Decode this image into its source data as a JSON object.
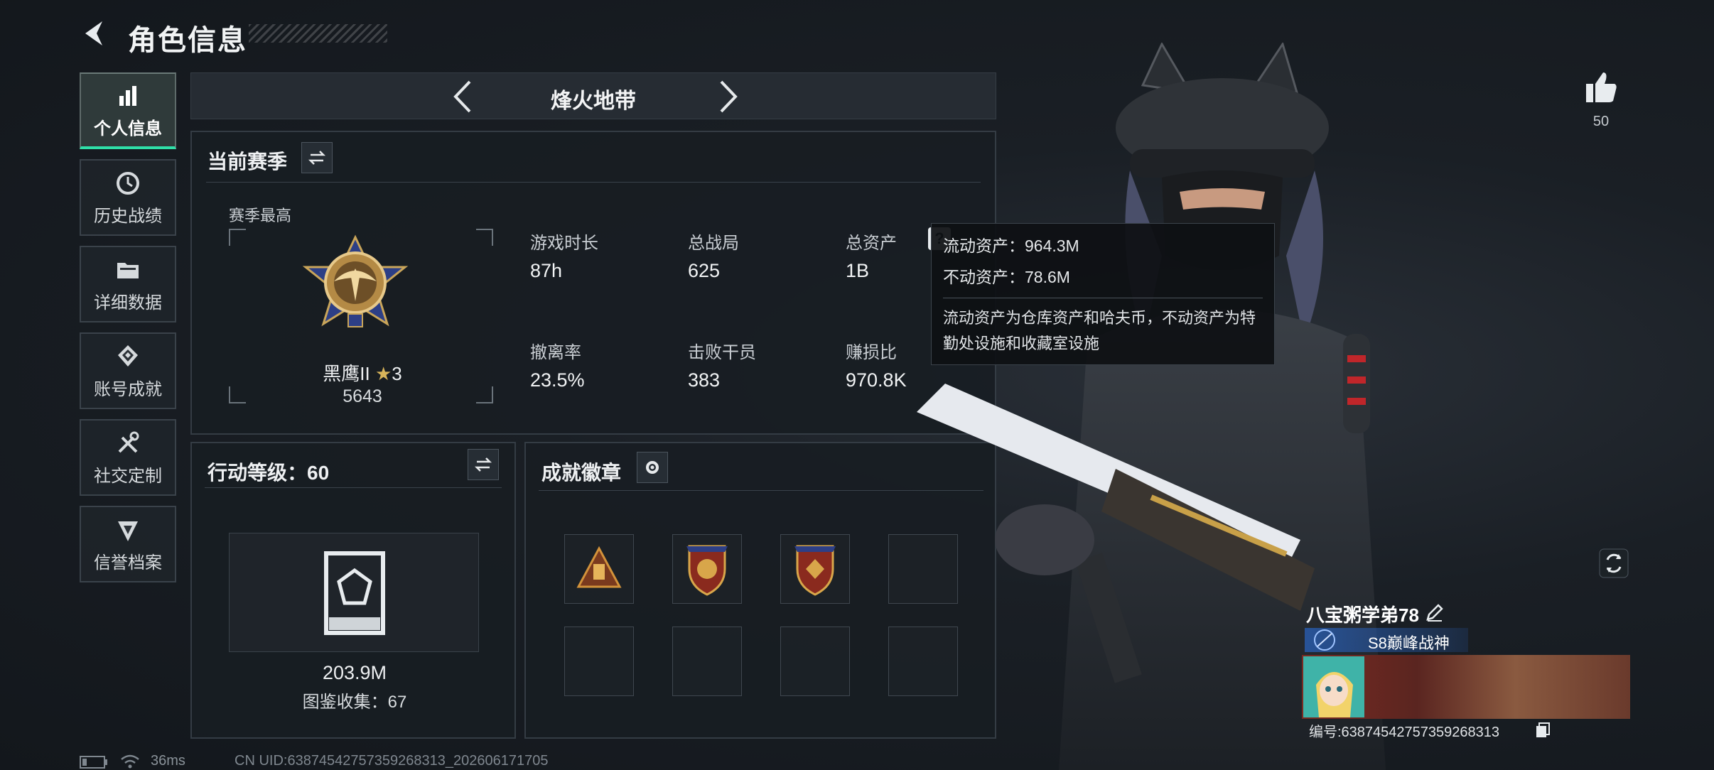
{
  "header": {
    "title": "角色信息"
  },
  "nav": {
    "items": [
      {
        "label": "个人信息",
        "icon": "bar-chart-icon",
        "active": true
      },
      {
        "label": "历史战绩",
        "icon": "history-clock-icon"
      },
      {
        "label": "详细数据",
        "icon": "folder-icon"
      },
      {
        "label": "账号成就",
        "icon": "achievement-icon"
      },
      {
        "label": "社交定制",
        "icon": "tools-icon"
      },
      {
        "label": "信誉档案",
        "icon": "shield-icon"
      }
    ]
  },
  "mode": {
    "title": "烽火地带"
  },
  "season": {
    "title": "当前赛季",
    "best_label": "赛季最高",
    "rank_name": "黑鹰II",
    "rank_stars": "3",
    "rank_points": "5643",
    "stats": [
      {
        "label": "游戏时长",
        "value": "87h"
      },
      {
        "label": "总战局",
        "value": "625"
      },
      {
        "label": "总资产",
        "value": "1B"
      },
      {
        "label": "撤离率",
        "value": "23.5%"
      },
      {
        "label": "击败干员",
        "value": "383"
      },
      {
        "label": "赚损比",
        "value": "970.8K"
      }
    ]
  },
  "tooltip": {
    "liquid": "流动资产：964.3M",
    "fixed": "不动资产：78.6M",
    "desc": "流动资产为仓库资产和哈夫币，不动资产为特勤处设施和收藏室设施"
  },
  "action_level": {
    "title": "行动等级：60",
    "value": "203.9M",
    "collection": "图鉴收集：67"
  },
  "achievements": {
    "title": "成就徽章"
  },
  "profile": {
    "likes": "50",
    "player_name": "八宝粥学弟78",
    "rank_title": "S8巅峰战神",
    "uid_line": "编号:638745427573592683​13"
  },
  "status": {
    "ping": "36ms",
    "uid_footer": "CN UID:638745427573592683​13_202606171705"
  },
  "colors": {
    "accent": "#2fe0a8",
    "panel": "#181d23"
  }
}
